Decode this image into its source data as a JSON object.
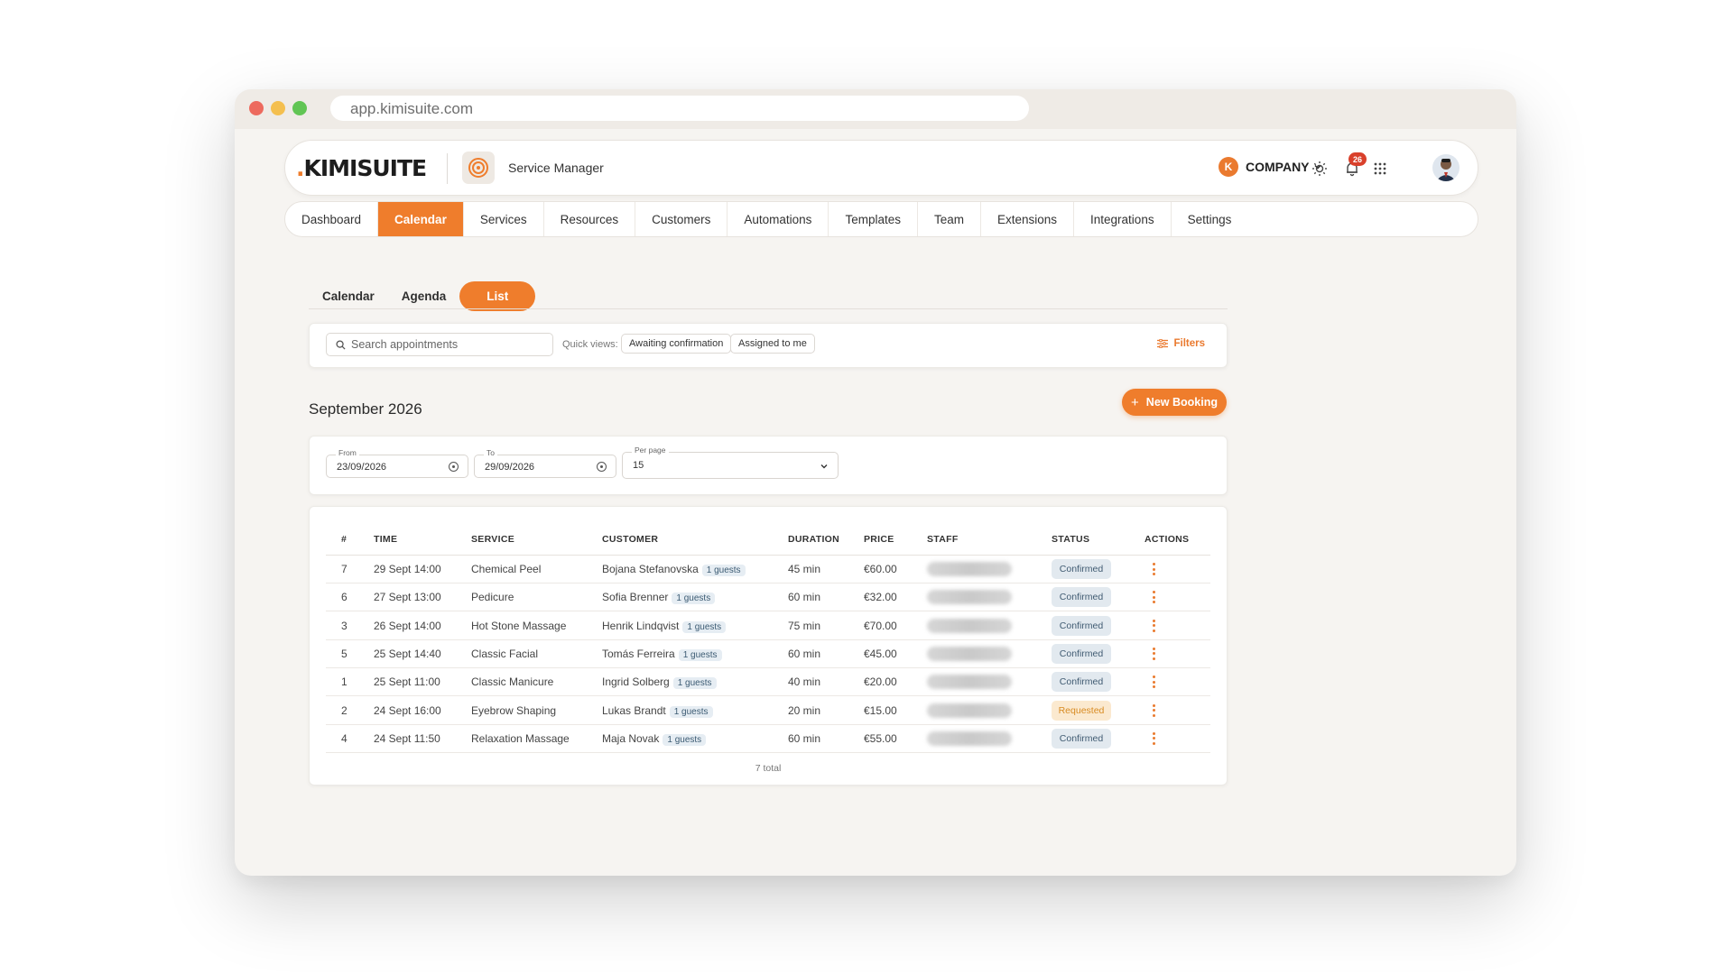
{
  "browser": {
    "url": "app.kimisuite.com"
  },
  "header": {
    "logo": "KIMISUITE",
    "app_name": "Service Manager",
    "company_initial": "K",
    "company": "COMPANY",
    "notifications": "26"
  },
  "nav": {
    "items": [
      "Dashboard",
      "Calendar",
      "Services",
      "Resources",
      "Customers",
      "Automations",
      "Templates",
      "Team",
      "Extensions",
      "Integrations",
      "Settings"
    ],
    "active": "Calendar"
  },
  "subtabs": {
    "items": [
      "Calendar",
      "Agenda",
      "List"
    ],
    "active": "List"
  },
  "search": {
    "placeholder": "Search appointments",
    "quick_views_label": "Quick views:",
    "quick_views": [
      "Awaiting confirmation",
      "Assigned to me"
    ],
    "filters_label": "Filters"
  },
  "period": {
    "title": "September 2026",
    "new_booking_label": "New Booking"
  },
  "filters": {
    "from_label": "From",
    "from_value": "23/09/2026",
    "to_label": "To",
    "to_value": "29/09/2026",
    "per_page_label": "Per page",
    "per_page_value": "15"
  },
  "table": {
    "columns": [
      "#",
      "TIME",
      "SERVICE",
      "CUSTOMER",
      "DURATION",
      "PRICE",
      "STAFF",
      "STATUS",
      "ACTIONS"
    ],
    "rows": [
      {
        "num": "7",
        "time": "29 Sept 14:00",
        "service": "Chemical Peel",
        "customer": "Bojana Stefanovska",
        "guests": "1 guests",
        "duration": "45 min",
        "price": "€60.00",
        "status": "Confirmed"
      },
      {
        "num": "6",
        "time": "27 Sept 13:00",
        "service": "Pedicure",
        "customer": "Sofia Brenner",
        "guests": "1 guests",
        "duration": "60 min",
        "price": "€32.00",
        "status": "Confirmed"
      },
      {
        "num": "3",
        "time": "26 Sept 14:00",
        "service": "Hot Stone Massage",
        "customer": "Henrik Lindqvist",
        "guests": "1 guests",
        "duration": "75 min",
        "price": "€70.00",
        "status": "Confirmed"
      },
      {
        "num": "5",
        "time": "25 Sept 14:40",
        "service": "Classic Facial",
        "customer": "Tomás Ferreira",
        "guests": "1 guests",
        "duration": "60 min",
        "price": "€45.00",
        "status": "Confirmed"
      },
      {
        "num": "1",
        "time": "25 Sept 11:00",
        "service": "Classic Manicure",
        "customer": "Ingrid Solberg",
        "guests": "1 guests",
        "duration": "40 min",
        "price": "€20.00",
        "status": "Confirmed"
      },
      {
        "num": "2",
        "time": "24 Sept 16:00",
        "service": "Eyebrow Shaping",
        "customer": "Lukas Brandt",
        "guests": "1 guests",
        "duration": "20 min",
        "price": "€15.00",
        "status": "Requested"
      },
      {
        "num": "4",
        "time": "24 Sept 11:50",
        "service": "Relaxation Massage",
        "customer": "Maja Novak",
        "guests": "1 guests",
        "duration": "60 min",
        "price": "€55.00",
        "status": "Confirmed"
      }
    ],
    "total": "7 total"
  },
  "colors": {
    "accent": "#ef7d2c",
    "confirmed_bg": "#e2e9ef",
    "requested_bg": "#fbe9cf"
  },
  "icons": [
    "search-icon",
    "filter-icon",
    "plus-icon",
    "calendar-icon",
    "chevron-down-icon",
    "sun-icon",
    "bell-icon",
    "apps-grid-icon",
    "kebab-menu-icon"
  ]
}
